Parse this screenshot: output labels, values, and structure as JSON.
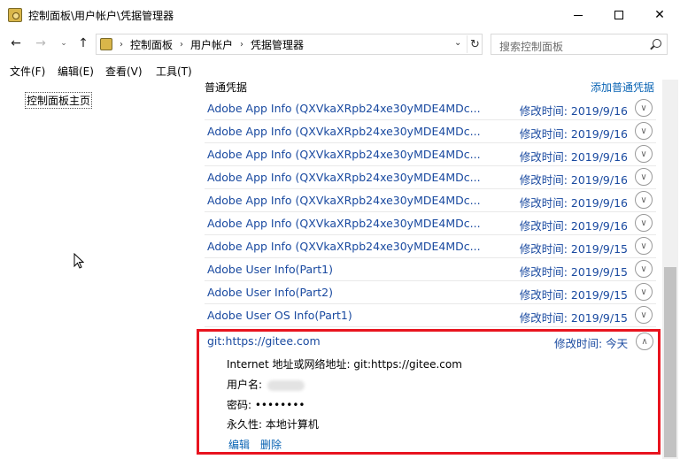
{
  "window": {
    "title": "控制面板\\用户帐户\\凭据管理器",
    "minimize_glyph": "",
    "close_glyph": "✕"
  },
  "nav": {
    "back_glyph": "←",
    "forward_glyph": "→",
    "recent_glyph": "⌄",
    "up_glyph": "↑"
  },
  "address": {
    "crumbs": [
      "控制面板",
      "用户帐户",
      "凭据管理器"
    ],
    "sep_glyph": "›",
    "dropdown_glyph": "⌄",
    "refresh_glyph": "↻"
  },
  "search": {
    "placeholder": "搜索控制面板"
  },
  "menu": [
    "文件(F)",
    "编辑(E)",
    "查看(V)",
    "工具(T)"
  ],
  "left_panel": {
    "home_link": "控制面板主页"
  },
  "content": {
    "section_title": "普通凭据",
    "add_link": "添加普通凭据",
    "credentials": [
      {
        "name": "Adobe App Info (QXVkaXRpb24xe30yMDE4MDc...",
        "modified": "修改时间:  2019/9/16"
      },
      {
        "name": "Adobe App Info (QXVkaXRpb24xe30yMDE4MDc...",
        "modified": "修改时间:  2019/9/16"
      },
      {
        "name": "Adobe App Info (QXVkaXRpb24xe30yMDE4MDc...",
        "modified": "修改时间:  2019/9/16"
      },
      {
        "name": "Adobe App Info (QXVkaXRpb24xe30yMDE4MDc...",
        "modified": "修改时间:  2019/9/16"
      },
      {
        "name": "Adobe App Info (QXVkaXRpb24xe30yMDE4MDc...",
        "modified": "修改时间:  2019/9/16"
      },
      {
        "name": "Adobe App Info (QXVkaXRpb24xe30yMDE4MDc...",
        "modified": "修改时间:  2019/9/16"
      },
      {
        "name": "Adobe App Info (QXVkaXRpb24xe30yMDE4MDc...",
        "modified": "修改时间:  2019/9/15"
      },
      {
        "name": "Adobe User Info(Part1)",
        "modified": "修改时间:  2019/9/15"
      },
      {
        "name": "Adobe User Info(Part2)",
        "modified": "修改时间:  2019/9/15"
      },
      {
        "name": "Adobe User OS Info(Part1)",
        "modified": "修改时间:  2019/9/15"
      }
    ],
    "chevron_down": "∨",
    "chevron_up": "∧",
    "expanded": {
      "name": "git:https://gitee.com",
      "modified": "修改时间:  今天",
      "address_label": "Internet 地址或网络地址:  git:https://gitee.com",
      "username_label": "用户名:",
      "password_label": "密码:  ••••••••",
      "persistence_label": "永久性:  本地计算机",
      "edit_link": "编辑",
      "delete_link": "删除"
    }
  },
  "colors": {
    "highlight_border": "#e8141f",
    "link": "#0a64b4",
    "row_text": "#1a4aa0"
  }
}
